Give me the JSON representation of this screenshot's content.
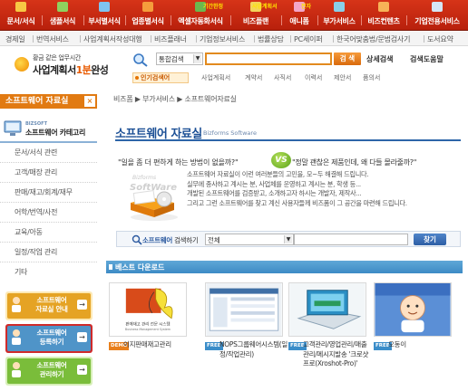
{
  "top_nav": {
    "items": [
      {
        "label": "문서/서식",
        "icon": "document-icon",
        "color": "#f7c844"
      },
      {
        "label": "샘플서식",
        "icon": "sample-icon",
        "color": "#8fd15e"
      },
      {
        "label": "부서별서식",
        "icon": "department-icon",
        "color": "#7fc3f0"
      },
      {
        "label": "업종별서식",
        "icon": "industry-icon",
        "color": "#f59d3c"
      },
      {
        "label": "엑셀자동화서식",
        "icon": "excel-icon",
        "color": "#6bb84e"
      },
      {
        "label": "비즈플랜",
        "icon": "bizplan-icon",
        "color": "#f3d55b"
      },
      {
        "label": "애니폼",
        "icon": "aniform-icon",
        "color": "#f3a6c9"
      },
      {
        "label": "부가서비스",
        "icon": "addon-icon",
        "color": "#89cfe8"
      },
      {
        "label": "비즈컨텐츠",
        "icon": "content-icon",
        "color": "#f7b357"
      },
      {
        "label": "기업전용서비스",
        "icon": "enterprise-icon",
        "color": "#d5e6f5"
      }
    ],
    "tags": {
      "excel": "기간한정",
      "bizplan": "사업계획서",
      "aniform": "전자"
    }
  },
  "sub_nav": {
    "links": [
      "경제일",
      "번역서비스",
      "사업계획서작성대행",
      "비즈플래너",
      "기업정보서비스",
      "법률상담",
      "PC세이퍼",
      "한국어맞춤법/문법검사기",
      "도서요약"
    ]
  },
  "header": {
    "logo_line1": "황금 같은 업무시간",
    "logo_line2_a": "사업계획서",
    "logo_line2_b": "1분",
    "logo_line2_c": "완성",
    "search_select": "통합검색",
    "search_button": "검 색",
    "detail_search": "상세검색",
    "search_help": "검색도움말",
    "popular": "인기검색어",
    "tags": [
      "사업계획서",
      "계약서",
      "사직서",
      "이력서",
      "제안서",
      "품의서"
    ]
  },
  "sidebar": {
    "title": "소프트웨어 자료실",
    "close": "×",
    "category_small": "BIZSOFT",
    "category": "소프트웨어 카테고리",
    "menu": [
      "문서/서식 관련",
      "고객/매장 관리",
      "판매/재고/회계/재무",
      "어학/번역/사전",
      "교육/아동",
      "일정/작업 관리",
      "기타"
    ],
    "buttons": [
      {
        "line1": "소프트웨어",
        "line2": "자료실 안내",
        "color": "#e5a324"
      },
      {
        "line1": "소프트웨어",
        "line2": "등록하기",
        "color": "#4f94c8"
      },
      {
        "line1": "소프트웨어",
        "line2": "관리하기",
        "color": "#7abd3a"
      }
    ],
    "go": "→"
  },
  "main": {
    "breadcrumb": "비즈폼 ▶ 부가서비스 ▶ 소프트웨어자료실",
    "title": "소프트웨어 자료실",
    "subtitle": "Bizforms Software",
    "q1": "\"일을 좀 더 편하게 하는 방법이 없을까?\"",
    "vs": "VS",
    "q2": "\"정말 괜찮은 제품인데, 왜 다들 몰라줄까?\"",
    "illus_small": "Bizforms",
    "illus_big": "SoftWare",
    "intro": [
      "소프트웨어 자료실이 이런 여러분들의 고민을, 모~두 해결해 드립니다.",
      "실무에 종사하고 계시는 분, 사업체를 운영하고 계시는 분, 학생 등...",
      "개발된 소프트웨어를 검증받고, 소개하고자 하시는 개발자, 제작사...",
      "그리고 그런 소프트웨어를 찾고 계신 사용자들께 비즈폼이 그 공간을 마련해 드립니다."
    ],
    "sw_search_label_a": "소프트웨어",
    "sw_search_label_b": " 검색하기",
    "sw_search_select": "전체",
    "sw_search_button": "찾기",
    "best_title": "베스트 다운로드",
    "products": [
      {
        "badge": "DEMO",
        "badge_color": "#e87f1c",
        "name": "이지판매재고관리"
      },
      {
        "badge": "FREE",
        "badge_color": "#3b8dc9",
        "name": "NOPS그룹웨어시스템(일정/작업관리)"
      },
      {
        "badge": "FREE",
        "badge_color": "#3b8dc9",
        "name": "고객관리/영업관리/매출관리/메시지발송 '크로샷프로(Xroshot-Pro)'"
      },
      {
        "badge": "FREE",
        "badge_color": "#3b8dc9",
        "name": "오동이"
      }
    ]
  }
}
